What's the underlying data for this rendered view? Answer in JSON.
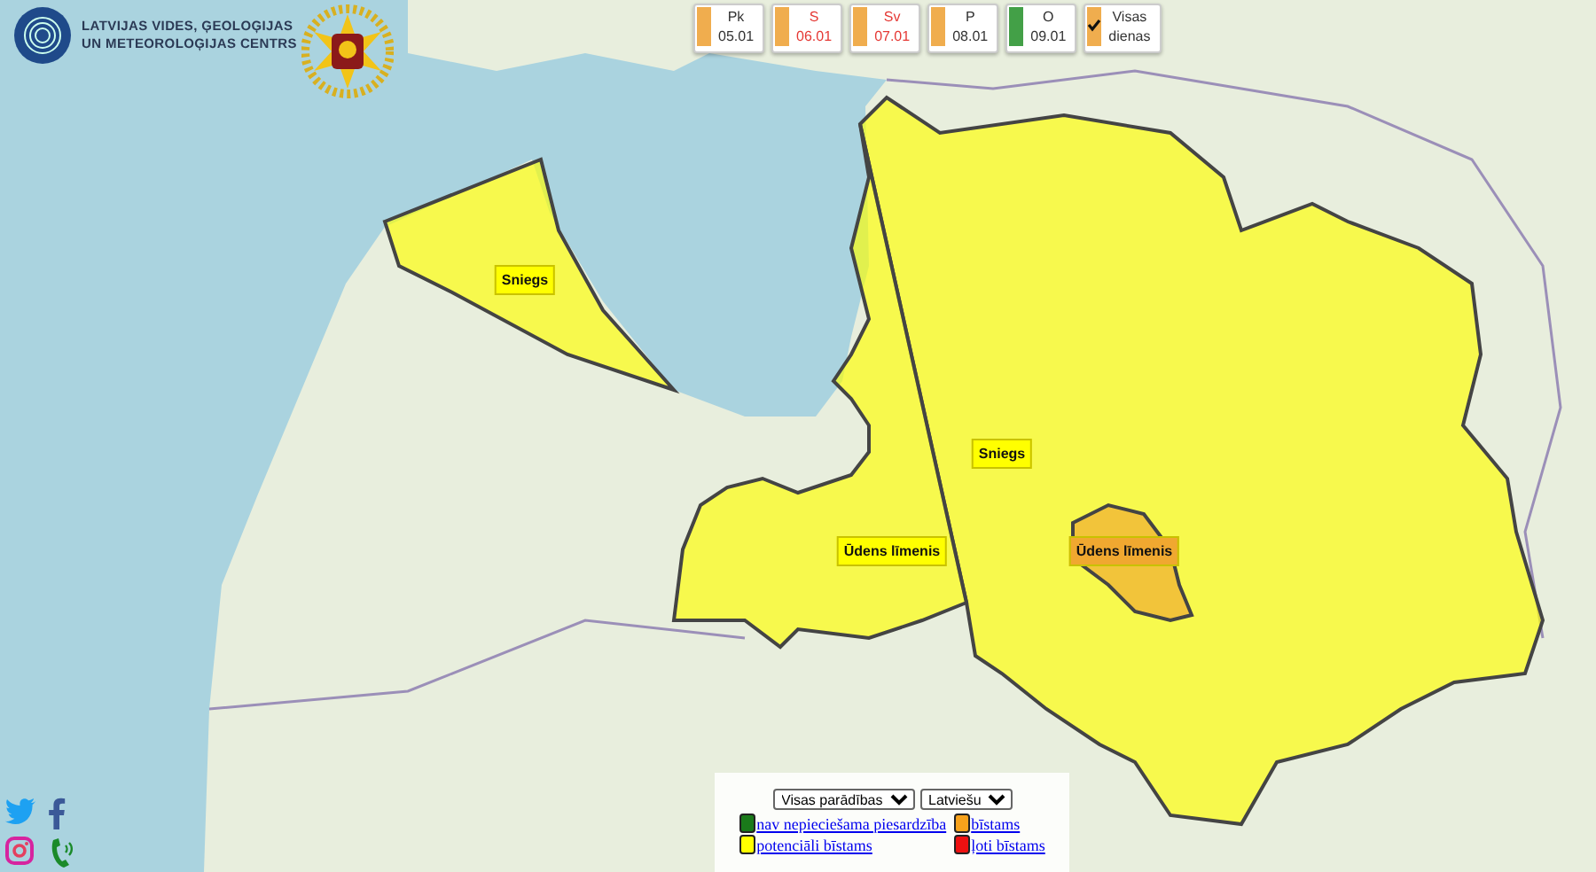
{
  "header": {
    "org_name": [
      "LATVIJAS VIDES, ĢEOLOĢIJAS",
      "UN METEOROLOĢIJAS CENTRS"
    ]
  },
  "days": [
    {
      "kind": "day",
      "label": "Pk",
      "date": "05.01",
      "color": "#f0ad4e",
      "weekend": false
    },
    {
      "kind": "day",
      "label": "S",
      "date": "06.01",
      "color": "#f0ad4e",
      "weekend": true
    },
    {
      "kind": "day",
      "label": "Sv",
      "date": "07.01",
      "color": "#f0ad4e",
      "weekend": true
    },
    {
      "kind": "day",
      "label": "P",
      "date": "08.01",
      "color": "#f0ad4e",
      "weekend": false
    },
    {
      "kind": "day",
      "label": "O",
      "date": "09.01",
      "color": "#43a047",
      "weekend": false
    },
    {
      "kind": "all",
      "label": "Visas",
      "date": "dienas",
      "color": "#f0ad4e",
      "checked": true
    }
  ],
  "warnings": [
    {
      "label": "Sniegs",
      "color": "#ffff00"
    },
    {
      "label": "Sniegs",
      "color": "#ffff00"
    },
    {
      "label": "Ūdens līmenis",
      "color": "#ffff00"
    },
    {
      "label": "Ūdens līmenis",
      "color": "#f0a830"
    }
  ],
  "controls": {
    "phenomenon_select": "Visas parādības",
    "language_select": "Latviešu"
  },
  "legend": [
    {
      "label": "nav nepieciešama piesardzība",
      "color": "#1a7a1a"
    },
    {
      "label": "bīstams",
      "color": "#f7a21b"
    },
    {
      "label": "potenciāli bīstams",
      "color": "#ffff00"
    },
    {
      "label": "ļoti bīstams",
      "color": "#ee1111"
    }
  ]
}
